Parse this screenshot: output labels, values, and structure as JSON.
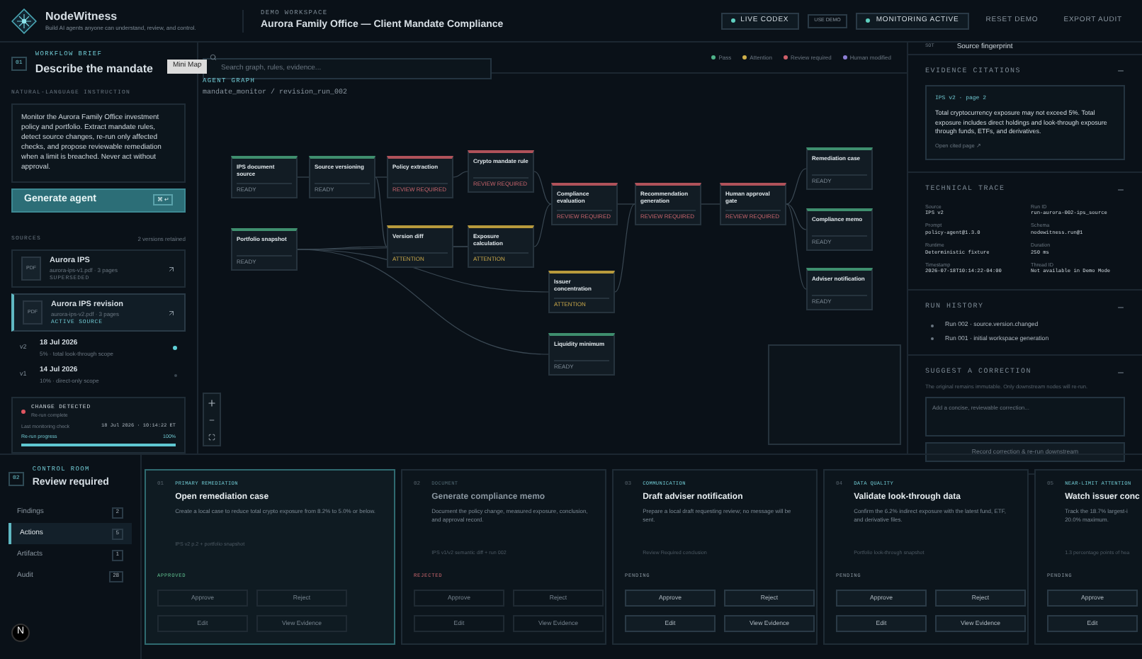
{
  "brand": {
    "name": "NodeWitness",
    "tagline": "Build AI agents anyone can understand, review, and control."
  },
  "workspace": {
    "label": "DEMO WORKSPACE",
    "title": "Aurora Family Office — Client Mandate Compliance"
  },
  "header_actions": [
    {
      "label": "LIVE CODEX",
      "kind": "status",
      "on": true
    },
    {
      "label": "USE DEMO",
      "kind": "small"
    },
    {
      "label": "MONITORING ACTIVE",
      "kind": "status",
      "on": true
    },
    {
      "label": "RESET DEMO",
      "kind": "plain"
    },
    {
      "label": "EXPORT AUDIT",
      "kind": "plain"
    }
  ],
  "tooltip": "Mini Map",
  "brief": {
    "step": "01",
    "label": "WORKFLOW BRIEF",
    "title": "Describe the mandate",
    "instruction_label": "NATURAL-LANGUAGE INSTRUCTION",
    "instruction": "Monitor the Aurora Family Office investment policy and portfolio. Extract mandate rules, detect source changes, re-run only affected checks, and propose reviewable remediation when a limit is breached. Never act without approval.",
    "generate_button": "Generate agent",
    "shortcut": "⌘ ↵"
  },
  "sources": {
    "label": "SOURCES",
    "count": "2 versions retained",
    "items": [
      {
        "file_type": "PDF",
        "name": "Aurora IPS",
        "meta": "aurora-ips-v1.pdf · 3 pages",
        "status": "SUPERSEDED",
        "selected": false
      },
      {
        "file_type": "PDF",
        "name": "Aurora IPS revision",
        "meta": "aurora-ips-v2.pdf · 3 pages",
        "status": "ACTIVE SOURCE",
        "selected": true
      }
    ],
    "versions": [
      {
        "tag": "v2",
        "date": "18 Jul 2026",
        "scope": "5% · total look-through scope",
        "selected": true
      },
      {
        "tag": "v1",
        "date": "14 Jul 2026",
        "scope": "10% · direct-only scope",
        "selected": false
      }
    ]
  },
  "change": {
    "title": "CHANGE DETECTED",
    "subtitle": "Re-run complete",
    "check_label": "Last monitoring check",
    "check_value": "18 Jul 2026 · 10:14:22 ET",
    "progress_label": "Re-run progress",
    "progress_value": "100%",
    "level": 1
  },
  "graph": {
    "search": {
      "placeholder": "Search graph, rules, evidence..."
    },
    "legend": [
      {
        "label": "Pass",
        "color": "#4fb38a"
      },
      {
        "label": "Attention",
        "color": "#d0b04a"
      },
      {
        "label": "Review required",
        "color": "#d0606a"
      },
      {
        "label": "Human modified",
        "color": "#8c7fd6"
      }
    ],
    "label": "AGENT GRAPH",
    "path": "mandate_monitor / revision_run_002",
    "nodes": [
      {
        "title": "IPS document source",
        "status": "READY",
        "kind": "ready"
      },
      {
        "title": "Source versioning",
        "status": "READY",
        "kind": "ready"
      },
      {
        "title": "Policy extraction",
        "status": "REVIEW REQUIRED",
        "kind": "review"
      },
      {
        "title": "Crypto mandate rule",
        "status": "REVIEW REQUIRED",
        "kind": "review"
      },
      {
        "title": "Portfolio snapshot",
        "status": "READY",
        "kind": "ready"
      },
      {
        "title": "Version diff",
        "status": "ATTENTION",
        "kind": "attention"
      },
      {
        "title": "Exposure calculation",
        "status": "ATTENTION",
        "kind": "attention"
      },
      {
        "title": "Compliance evaluation",
        "status": "REVIEW REQUIRED",
        "kind": "review"
      },
      {
        "title": "Recommendation generation",
        "status": "REVIEW REQUIRED",
        "kind": "review"
      },
      {
        "title": "Human approval gate",
        "status": "REVIEW REQUIRED",
        "kind": "review"
      },
      {
        "title": "Issuer concentration",
        "status": "ATTENTION",
        "kind": "attention"
      },
      {
        "title": "Liquidity minimum",
        "status": "READY",
        "kind": "ready"
      },
      {
        "title": "Remediation case",
        "status": "READY",
        "kind": "ready"
      },
      {
        "title": "Compliance memo",
        "status": "READY",
        "kind": "ready"
      },
      {
        "title": "Adviser notification",
        "status": "READY",
        "kind": "ready"
      }
    ]
  },
  "inspector": {
    "tag": "SOT",
    "title": "Source fingerprint",
    "citations": {
      "label": "EVIDENCE CITATIONS",
      "expanded": true,
      "ref": "IPS v2 · page 2",
      "quote": "Total cryptocurrency exposure may not exceed 5%. Total exposure includes direct holdings and look-through exposure through funds, ETFs, and derivatives.",
      "link": "Open cited page ↗"
    },
    "trace": {
      "label": "TECHNICAL TRACE",
      "expanded": true,
      "fields": [
        {
          "key": "Source",
          "value": "IPS v2"
        },
        {
          "key": "Run ID",
          "value": "run-aurora-002-ips_source"
        },
        {
          "key": "Prompt",
          "value": "policy-agent@1.3.0"
        },
        {
          "key": "Schema",
          "value": "nodewitness.run@1"
        },
        {
          "key": "Runtime",
          "value": "Deterministic fixture"
        },
        {
          "key": "Duration",
          "value": "250 ms"
        },
        {
          "key": "Timestamp",
          "value": "2026-07-18T10:14:22-04:00"
        },
        {
          "key": "Thread ID",
          "value": "Not available in Demo Mode"
        }
      ]
    },
    "history": {
      "label": "RUN HISTORY",
      "expanded": true,
      "items": [
        "Run 002 · source.version.changed",
        "Run 001 · initial workspace generation"
      ]
    },
    "correction": {
      "label": "SUGGEST A CORRECTION",
      "expanded": true,
      "note": "The original remains immutable. Only downstream nodes will re-run.",
      "placeholder": "Add a concise, reviewable correction...",
      "button": "Record correction & re-run downstream"
    }
  },
  "control": {
    "step": "02",
    "label": "CONTROL ROOM",
    "title": "Review required",
    "nav": [
      {
        "label": "Findings",
        "count": "2",
        "selected": false
      },
      {
        "label": "Actions",
        "count": "5",
        "selected": true
      },
      {
        "label": "Artifacts",
        "count": "1",
        "selected": false
      },
      {
        "label": "Audit",
        "count": "28",
        "selected": false
      }
    ],
    "avatar": "N"
  },
  "actions": [
    {
      "number": "01",
      "category": "PRIMARY REMEDIATION",
      "title": "Open remediation case",
      "description": "Create a local case to reduce total crypto exposure from 8.2% to 5.0% or below.",
      "source": "IPS v2 p.2 + portfolio snapshot",
      "status": "APPROVED",
      "kind": "approved",
      "selected": true,
      "buttons": [
        "Approve",
        "Edit",
        "Reject",
        "View Evidence"
      ]
    },
    {
      "number": "02",
      "category": "DOCUMENT",
      "title": "Generate compliance memo",
      "description": "Document the policy change, measured exposure, conclusion, and approval record.",
      "source": "IPS v1/v2 semantic diff + run 002",
      "status": "REJECTED",
      "kind": "rejected",
      "selected": false,
      "buttons": [
        "Approve",
        "Edit",
        "Reject",
        "View Evidence"
      ]
    },
    {
      "number": "03",
      "category": "COMMUNICATION",
      "title": "Draft adviser notification",
      "description": "Prepare a local draft requesting review; no message will be sent.",
      "source": "Review Required conclusion",
      "status": "PENDING",
      "kind": "pending",
      "selected": false,
      "buttons": [
        "Approve",
        "Edit",
        "Reject",
        "View Evidence"
      ]
    },
    {
      "number": "04",
      "category": "DATA QUALITY",
      "title": "Validate look-through data",
      "description": "Confirm the 6.2% indirect exposure with the latest fund, ETF, and derivative files.",
      "source": "Portfolio look-through snapshot",
      "status": "PENDING",
      "kind": "pending",
      "selected": false,
      "buttons": [
        "Approve",
        "Edit",
        "Reject",
        "View Evidence"
      ]
    },
    {
      "number": "05",
      "category": "NEAR-LIMIT ATTENTION",
      "title": "Watch issuer conc",
      "description": "Track the 18.7% largest-i\n20.0% maximum.",
      "source": "1.3 percentage points of hea",
      "status": "PENDING",
      "kind": "pending",
      "selected": false,
      "buttons": [
        "Approve",
        "Edit"
      ]
    }
  ]
}
